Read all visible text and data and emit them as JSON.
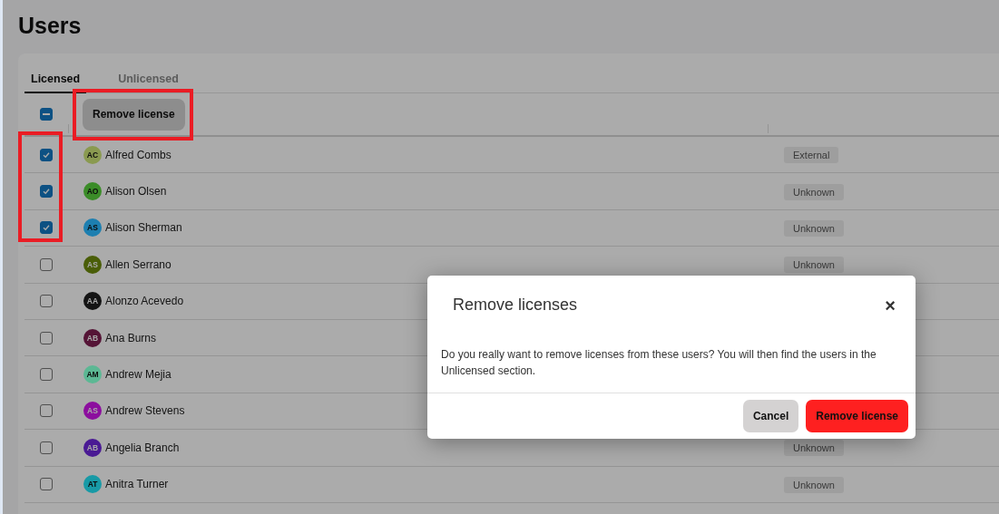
{
  "page": {
    "title": "Users"
  },
  "tabs": [
    {
      "label": "Licensed",
      "selected": true
    },
    {
      "label": "Unlicensed",
      "selected": false
    }
  ],
  "toolbar": {
    "select_all": {
      "indeterminate": true
    },
    "remove_button": {
      "label": "Remove license",
      "highlighted": true
    }
  },
  "users": [
    {
      "initials": "AC",
      "name": "Alfred Combs",
      "color": "#8a9a50",
      "badge": "External",
      "checked": true,
      "highlighted": true
    },
    {
      "initials": "AO",
      "name": "Alison Olsen",
      "color": "#3b8c28",
      "badge": "Unknown",
      "checked": true,
      "highlighted": true
    },
    {
      "initials": "AS",
      "name": "Alison Sherman",
      "color": "#1d7fb0",
      "badge": "Unknown",
      "checked": true,
      "highlighted": true
    },
    {
      "initials": "AS",
      "name": "Allen Serrano",
      "color": "#4a5e08",
      "badge": "Unknown",
      "checked": false,
      "highlighted": false
    },
    {
      "initials": "AA",
      "name": "Alonzo Acevedo",
      "color": "#141414",
      "checked": false,
      "highlighted": false
    },
    {
      "initials": "AB",
      "name": "Ana Burns",
      "color": "#551436",
      "checked": false,
      "highlighted": false
    },
    {
      "initials": "AM",
      "name": "Andrew Mejia",
      "color": "#5cb894",
      "checked": false,
      "highlighted": false
    },
    {
      "initials": "AS",
      "name": "Andrew Stevens",
      "color": "#8c0e9e",
      "checked": false,
      "highlighted": false
    },
    {
      "initials": "AB",
      "name": "Angelia Branch",
      "color": "#4a1a94",
      "badge": "Unknown",
      "checked": false,
      "highlighted": false
    },
    {
      "initials": "AT",
      "name": "Anitra Turner",
      "color": "#189aa6",
      "badge": "Unknown",
      "checked": false,
      "highlighted": false
    }
  ],
  "dialog": {
    "title": "Remove licenses",
    "close": "×",
    "message": "Do you really want to remove licenses from these users? You will then find the users in the Unlicensed section.",
    "buttons": [
      {
        "kind": "secondary",
        "label": "Cancel"
      },
      {
        "kind": "danger",
        "label": "Remove license"
      }
    ]
  }
}
